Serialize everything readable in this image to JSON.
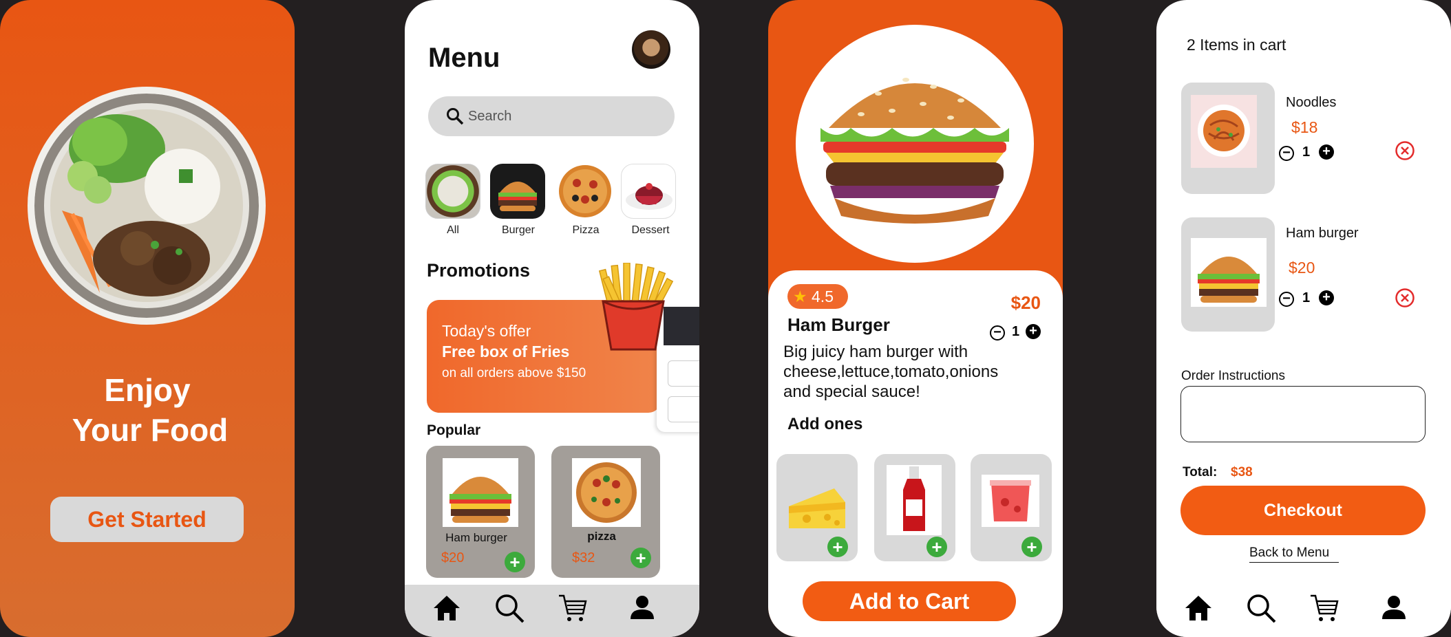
{
  "welcome": {
    "title_line1": "Enjoy",
    "title_line2": "Your Food",
    "cta": "Get Started"
  },
  "menu": {
    "title": "Menu",
    "search_placeholder": "Search",
    "categories": [
      {
        "label": "All"
      },
      {
        "label": "Burger"
      },
      {
        "label": "Pizza"
      },
      {
        "label": "Dessert"
      }
    ],
    "promotions_heading": "Promotions",
    "promo": {
      "line1": "Today's offer",
      "line2": "Free box of Fries",
      "line3": "on all orders above $150"
    },
    "popular_heading": "Popular",
    "popular": [
      {
        "name": "Ham burger",
        "price": "$20"
      },
      {
        "name": "pizza",
        "price": "$32"
      }
    ]
  },
  "detail": {
    "rating": "4.5",
    "price": "$20",
    "name": "Ham Burger",
    "qty": "1",
    "description": "Big juicy ham burger with cheese,lettuce,tomato,onions and special sauce!",
    "addons_heading": "Add ones",
    "add_to_cart": "Add to Cart"
  },
  "cart": {
    "title": "2 Items in cart",
    "items": [
      {
        "name": "Noodles",
        "price": "$18",
        "qty": "1"
      },
      {
        "name": "Ham burger",
        "price": "$20",
        "qty": "1"
      }
    ],
    "instructions_label": "Order Instructions",
    "total_label": "Total:",
    "total_value": "$38",
    "checkout": "Checkout",
    "back": "Back to Menu"
  },
  "colors": {
    "accent": "#e85613",
    "green": "#3caa3c",
    "grey": "#d9d9d9"
  }
}
